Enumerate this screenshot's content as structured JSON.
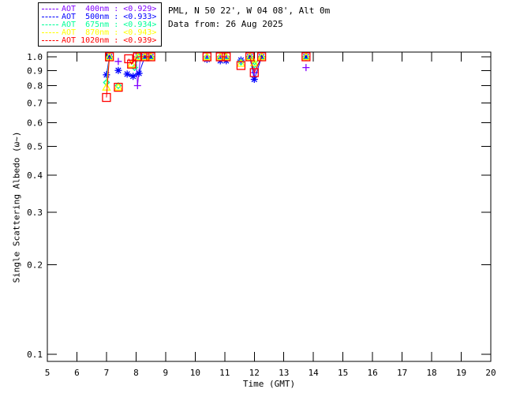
{
  "header": {
    "line1": "PML, N 50 22', W 04 08', Alt 0m",
    "line2": "Data from: 26 Aug 2025"
  },
  "chart_data": {
    "type": "scatter",
    "title": "",
    "xlabel": "Time (GMT)",
    "ylabel": "Single Scattering Albedo (ω~)",
    "x_axis": {
      "label": "Time (GMT)",
      "min": 5,
      "max": 20,
      "ticks": [
        5,
        6,
        7,
        8,
        9,
        10,
        11,
        12,
        13,
        14,
        15,
        16,
        17,
        18,
        19,
        20
      ]
    },
    "y_axis": {
      "label": "Single Scattering Albedo (ω~)",
      "min": 0.1,
      "max": 1.0,
      "scale": "log",
      "ticks": [
        1.0,
        0.9,
        0.8,
        0.7,
        0.6,
        0.5,
        0.4,
        0.3,
        0.2,
        0.1
      ],
      "tick_labels": [
        "1.0",
        "0.9",
        "0.8",
        "0.7",
        "0.6",
        "0.5",
        "0.4",
        "0.3",
        "0.2",
        "0.1"
      ]
    },
    "legend_position": "top-left",
    "grid": false,
    "gap_threshold_hours": 0.28,
    "series": [
      {
        "name": "AOT 400nm",
        "legend_label": "AOT  400nm : <0.929>",
        "mean_value": 0.929,
        "color": "#8000ff",
        "marker": "plus",
        "points": [
          [
            7.1,
            1.0
          ],
          [
            7.4,
            0.965
          ],
          [
            8.0,
            1.0
          ],
          [
            8.05,
            0.8
          ],
          [
            8.15,
            1.0
          ],
          [
            8.3,
            1.0
          ],
          [
            8.5,
            1.0
          ],
          [
            10.4,
            1.0
          ],
          [
            10.85,
            1.0
          ],
          [
            11.05,
            1.0
          ],
          [
            11.85,
            1.0
          ],
          [
            12.0,
            0.885
          ],
          [
            12.25,
            1.0
          ],
          [
            13.75,
            0.92
          ]
        ]
      },
      {
        "name": "AOT 500nm",
        "legend_label": "AOT  500nm : <0.933>",
        "mean_value": 0.933,
        "color": "#0000ff",
        "marker": "asterisk",
        "points": [
          [
            7.0,
            0.87
          ],
          [
            7.1,
            1.0
          ],
          [
            7.4,
            0.9
          ],
          [
            7.7,
            0.875
          ],
          [
            7.9,
            0.86
          ],
          [
            8.1,
            0.88
          ],
          [
            8.3,
            1.0
          ],
          [
            8.5,
            1.0
          ],
          [
            10.4,
            0.98
          ],
          [
            10.85,
            0.97
          ],
          [
            11.05,
            0.97
          ],
          [
            11.55,
            0.975
          ],
          [
            11.85,
            1.0
          ],
          [
            12.0,
            0.84
          ],
          [
            12.25,
            1.0
          ],
          [
            13.75,
            1.0
          ]
        ]
      },
      {
        "name": "AOT 675nm",
        "legend_label": "AOT  675nm : <0.934>",
        "mean_value": 0.934,
        "color": "#00ff99",
        "marker": "diamond",
        "points": [
          [
            7.0,
            0.82
          ],
          [
            7.1,
            1.0
          ],
          [
            7.4,
            0.8
          ],
          [
            7.95,
            0.92
          ],
          [
            8.1,
            1.0
          ],
          [
            8.3,
            1.0
          ],
          [
            8.5,
            1.0
          ],
          [
            10.4,
            1.0
          ],
          [
            10.85,
            1.0
          ],
          [
            11.05,
            1.0
          ],
          [
            11.55,
            0.96
          ],
          [
            11.85,
            1.0
          ],
          [
            12.0,
            0.94
          ],
          [
            12.25,
            1.0
          ],
          [
            13.75,
            1.0
          ]
        ]
      },
      {
        "name": "AOT 870nm",
        "legend_label": "AOT  870nm : <0.943>",
        "mean_value": 0.943,
        "color": "#ffff00",
        "marker": "triangle",
        "points": [
          [
            7.0,
            0.79
          ],
          [
            7.1,
            1.0
          ],
          [
            7.4,
            0.79
          ],
          [
            7.85,
            0.945
          ],
          [
            8.05,
            1.0
          ],
          [
            8.3,
            1.0
          ],
          [
            8.5,
            1.0
          ],
          [
            10.4,
            1.0
          ],
          [
            10.85,
            1.0
          ],
          [
            11.05,
            1.0
          ],
          [
            11.55,
            0.95
          ],
          [
            11.85,
            1.0
          ],
          [
            12.0,
            0.955
          ],
          [
            12.25,
            1.0
          ],
          [
            13.75,
            1.0
          ]
        ]
      },
      {
        "name": "AOT 1020nm",
        "legend_label": "AOT 1020nm : <0.939>",
        "mean_value": 0.939,
        "color": "#ff0000",
        "marker": "square",
        "points": [
          [
            7.0,
            0.73
          ],
          [
            7.1,
            1.0
          ],
          [
            7.4,
            0.79
          ],
          [
            7.75,
            0.985
          ],
          [
            7.85,
            0.945
          ],
          [
            8.05,
            1.0
          ],
          [
            8.3,
            1.0
          ],
          [
            8.5,
            1.0
          ],
          [
            10.4,
            1.0
          ],
          [
            10.85,
            1.0
          ],
          [
            11.05,
            1.0
          ],
          [
            11.55,
            0.935
          ],
          [
            11.85,
            1.0
          ],
          [
            12.0,
            0.885
          ],
          [
            12.25,
            1.0
          ],
          [
            13.75,
            1.0
          ]
        ]
      }
    ]
  }
}
